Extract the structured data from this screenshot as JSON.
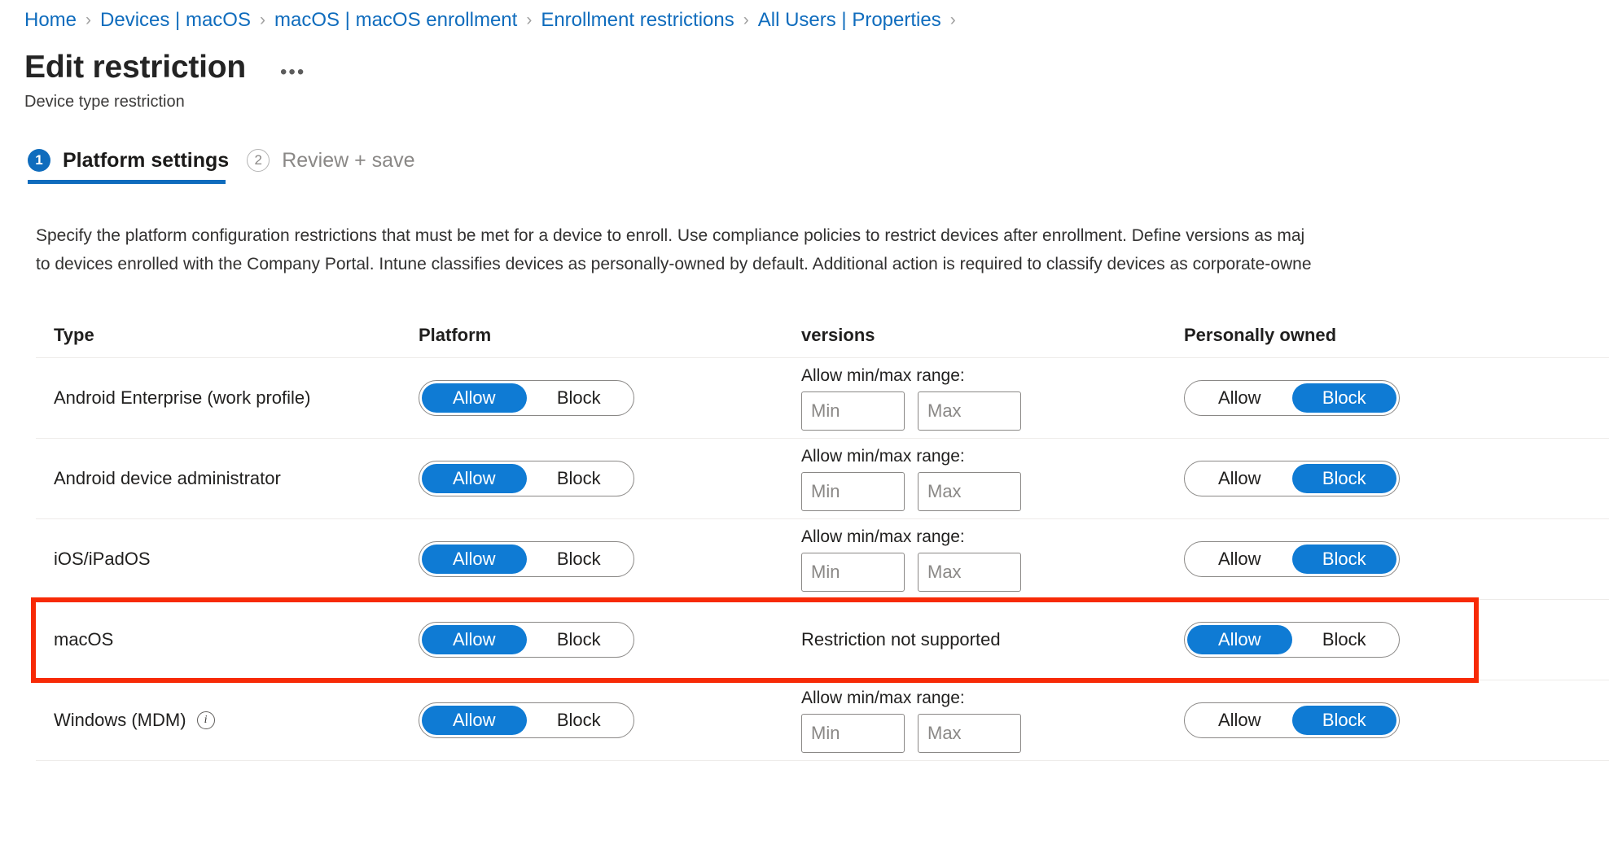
{
  "breadcrumb": {
    "separator": "›",
    "items": [
      {
        "label": "Home"
      },
      {
        "label": "Devices | macOS"
      },
      {
        "label": "macOS | macOS enrollment"
      },
      {
        "label": "Enrollment restrictions"
      },
      {
        "label": "All Users | Properties"
      }
    ],
    "trailing_separator": "›"
  },
  "header": {
    "title": "Edit restriction",
    "more_actions": "•••",
    "subtitle": "Device type restriction"
  },
  "wizard": {
    "steps": [
      {
        "number": "1",
        "label": "Platform settings",
        "state": "active"
      },
      {
        "number": "2",
        "label": "Review + save",
        "state": "inactive"
      }
    ]
  },
  "description": {
    "line1": "Specify the platform configuration restrictions that must be met for a device to enroll. Use compliance policies to restrict devices after enrollment. Define versions as maj",
    "line2": "to devices enrolled with the Company Portal. Intune classifies devices as personally-owned by default. Additional action is required to classify devices as corporate-owne"
  },
  "table": {
    "headers": {
      "type": "Type",
      "platform": "Platform",
      "versions": "versions",
      "personally_owned": "Personally owned"
    },
    "toggle_options": {
      "allow": "Allow",
      "block": "Block"
    },
    "range_label": "Allow min/max range:",
    "min_placeholder": "Min",
    "max_placeholder": "Max",
    "min_value": "",
    "max_value": "",
    "rows": [
      {
        "type": "Android Enterprise (work profile)",
        "has_info_icon": false,
        "platform_selected": "Allow",
        "versions_mode": "range",
        "versions_text": "",
        "owned_selected": "Block",
        "highlighted": false
      },
      {
        "type": "Android device administrator",
        "has_info_icon": false,
        "platform_selected": "Allow",
        "versions_mode": "range",
        "versions_text": "",
        "owned_selected": "Block",
        "highlighted": false
      },
      {
        "type": "iOS/iPadOS",
        "has_info_icon": false,
        "platform_selected": "Allow",
        "versions_mode": "range",
        "versions_text": "",
        "owned_selected": "Block",
        "highlighted": false
      },
      {
        "type": "macOS",
        "has_info_icon": false,
        "platform_selected": "Allow",
        "versions_mode": "text",
        "versions_text": "Restriction not supported",
        "owned_selected": "Allow",
        "highlighted": true
      },
      {
        "type": "Windows (MDM)",
        "has_info_icon": true,
        "info_icon_glyph": "i",
        "platform_selected": "Allow",
        "versions_mode": "range",
        "versions_text": "",
        "owned_selected": "Block",
        "highlighted": false
      }
    ]
  },
  "colors": {
    "accent_blue": "#0f7bd4",
    "link_blue": "#0f6cbd",
    "highlight_red": "#f72a06",
    "row_divider": "#edebe9"
  }
}
